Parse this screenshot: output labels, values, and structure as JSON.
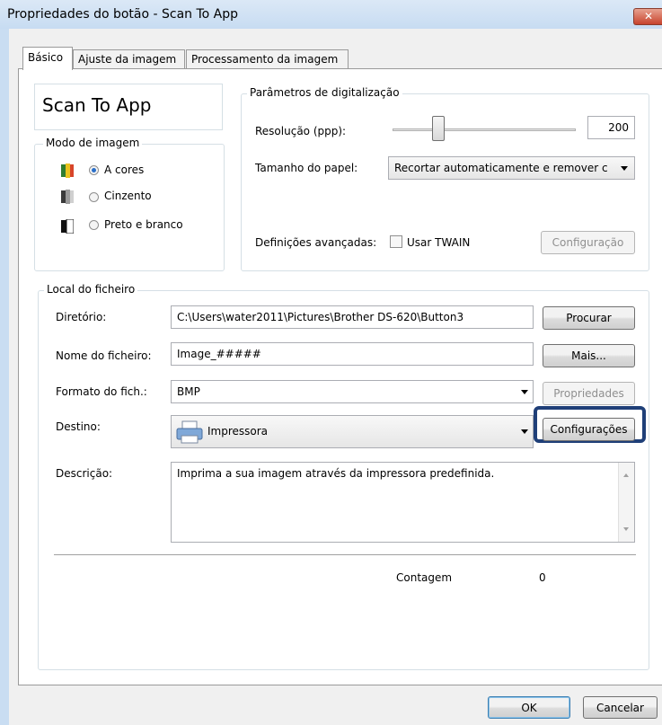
{
  "window": {
    "title": "Propriedades do botão - Scan To App",
    "close_glyph": "✕"
  },
  "tabs": [
    {
      "label": "Básico",
      "active": true
    },
    {
      "label": "Ajuste da imagem",
      "active": false
    },
    {
      "label": "Processamento da imagem",
      "active": false
    }
  ],
  "app_name": "Scan To App",
  "image_mode": {
    "legend": "Modo de imagem",
    "options": [
      {
        "label": "A cores",
        "selected": true,
        "icon": "color-mode-icon"
      },
      {
        "label": "Cinzento",
        "selected": false,
        "icon": "grayscale-mode-icon"
      },
      {
        "label": "Preto e branco",
        "selected": false,
        "icon": "black-white-mode-icon"
      }
    ]
  },
  "scan_params": {
    "legend": "Parâmetros de digitalização",
    "resolution_label": "Resolução (ppp):",
    "resolution_value": "200",
    "paper_size_label": "Tamanho do papel:",
    "paper_size_value": "Recortar automaticamente e remover c",
    "advanced_label": "Definições avançadas:",
    "twain_label": "Usar TWAIN",
    "twain_checked": false,
    "config_button": "Configuração"
  },
  "file_location": {
    "legend": "Local do ficheiro",
    "directory_label": "Diretório:",
    "directory_value": "C:\\Users\\water2011\\Pictures\\Brother DS-620\\Button3",
    "browse_button": "Procurar",
    "filename_label": "Nome do ficheiro:",
    "filename_value": "Image_#####",
    "more_button": "Mais...",
    "format_label": "Formato do fich.:",
    "format_value": "BMP",
    "properties_button": "Propriedades",
    "destination_label": "Destino:",
    "destination_value": "Impressora",
    "destination_icon": "printer-icon",
    "settings_button": "Configurações",
    "description_label": "Descrição:",
    "description_value": "Imprima a sua imagem através da impressora predefinida.",
    "count_label": "Contagem",
    "count_value": "0"
  },
  "footer": {
    "ok_button": "OK",
    "cancel_button": "Cancelar"
  },
  "colors": {
    "highlight_outline": "#1f3f78",
    "radio_selected": "#2a6fc9",
    "close_button": "#c7432d"
  }
}
